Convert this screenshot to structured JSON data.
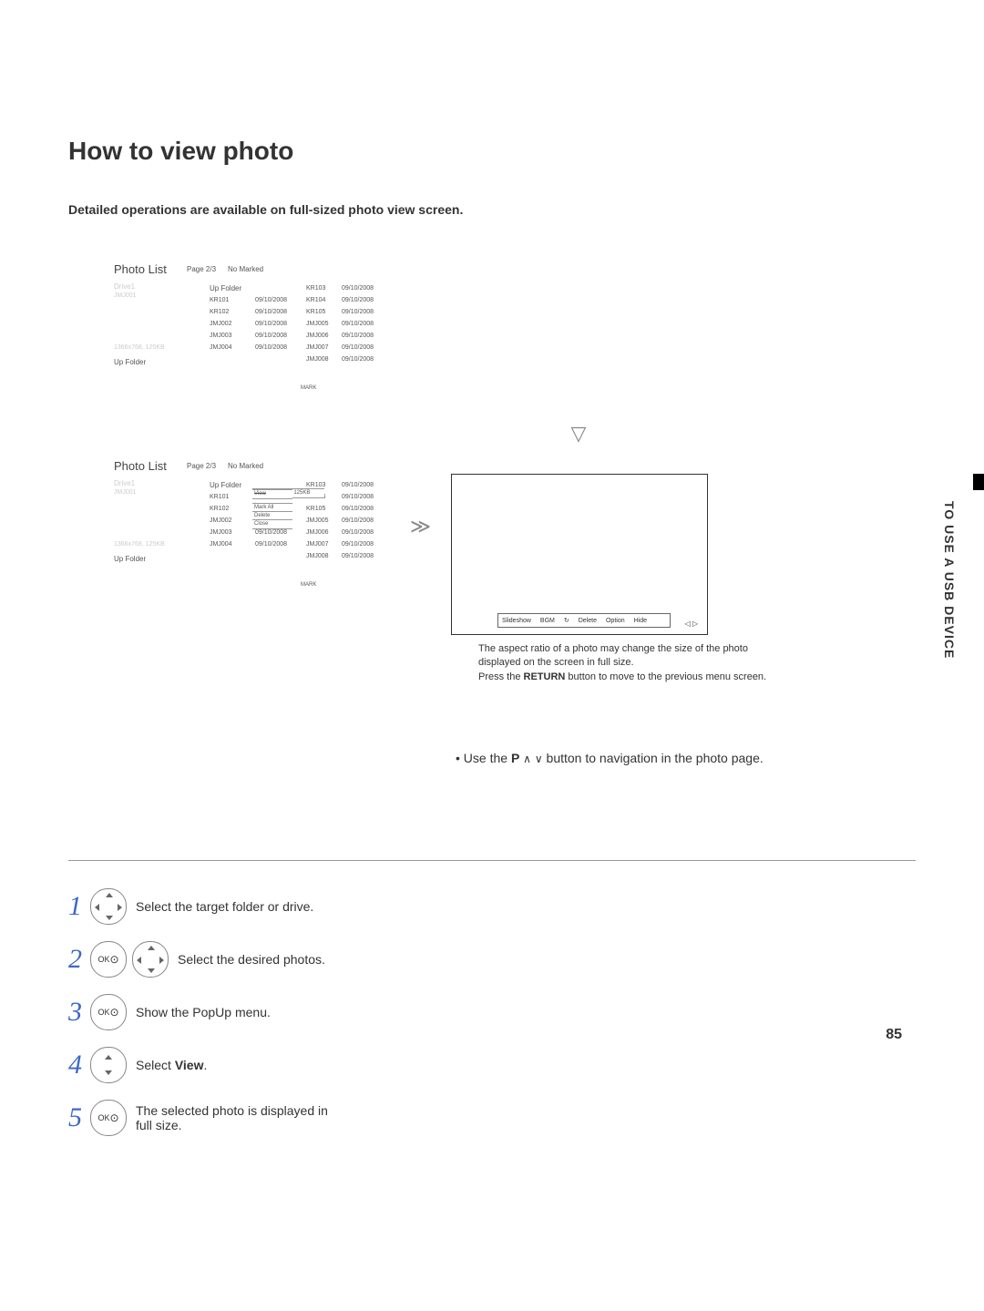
{
  "page": {
    "title": "How to view photo",
    "subtitle": "Detailed operations are available on full-sized photo view screen.",
    "side_vertical": "TO USE A USB DEVICE",
    "number": "85"
  },
  "panelA": {
    "title": "Photo List",
    "page": "Page 2/3",
    "marked": "No Marked",
    "drive": "Drive1",
    "jmj": "JMJ001",
    "res": "1366x768, 125KB",
    "upfolder": "Up Folder",
    "c1_up": "Up Folder",
    "c1": [
      "KR101",
      "KR102",
      "",
      "JMJ002",
      "JMJ003",
      "JMJ004"
    ],
    "c2": [
      "09/10/2008",
      "09/10/2008",
      "",
      "09/10/2008",
      "09/10/2008",
      "09/10/2008"
    ],
    "c3": [
      "KR103",
      "KR104",
      "KR105",
      "JMJ005",
      "JMJ006",
      "JMJ007",
      "JMJ008"
    ],
    "c4": [
      "09/10/2008",
      "09/10/2008",
      "09/10/2008",
      "09/10/2008",
      "09/10/2008",
      "09/10/2008",
      "09/10/2008"
    ],
    "mark": "MARK"
  },
  "panelB": {
    "title": "Photo List",
    "page": "Page 2/3",
    "marked": "No Marked",
    "drive": "Drive1",
    "jmj": "JMJ001",
    "res": "1366x768, 125KB",
    "upfolder": "Up Folder",
    "c1_up": "Up Folder",
    "c1": [
      "KR101",
      "KR102",
      "",
      "JMJ002",
      "JMJ003",
      "JMJ004"
    ],
    "c2": [
      "09/10/2008",
      "09/10/2008",
      "",
      "09/10/2008",
      "09/10/2008",
      "09/10/2008"
    ],
    "c3": [
      "KR103",
      "KR104",
      "KR105",
      "JMJ005",
      "JMJ006",
      "JMJ007",
      "JMJ008"
    ],
    "c4": [
      "09/10/2008",
      "09/10/2008",
      "09/10/2008",
      "09/10/2008",
      "09/10/2008",
      "09/10/2008",
      "09/10/2008"
    ],
    "popup_info": "1366x768, 125KB",
    "popup": [
      "View",
      "Mark All",
      "Delete",
      "Close"
    ],
    "mark": "MARK"
  },
  "fullview": {
    "buttons": [
      "Slideshow",
      "BGM",
      "",
      "Delete",
      "Option",
      "Hide"
    ]
  },
  "notes": {
    "line1": "The aspect ratio of a photo may change the size of the photo displayed on the screen in full size.",
    "line2a": "Press the ",
    "line2b": "RETURN",
    "line2c": " button to move to the previous menu screen."
  },
  "steps": {
    "s1": "Select the target folder or drive.",
    "s2": "Select the desired photos.",
    "s3": "Show the PopUp menu.",
    "s4a": "Select ",
    "s4b": "View",
    "s4c": ".",
    "s5": "The selected photo is displayed in full size."
  },
  "tip": {
    "bullet": "• Use the ",
    "p": "P",
    "rest": " button to navigation in the photo page."
  },
  "ok_label": "OK",
  "ok_dot": "⊙"
}
